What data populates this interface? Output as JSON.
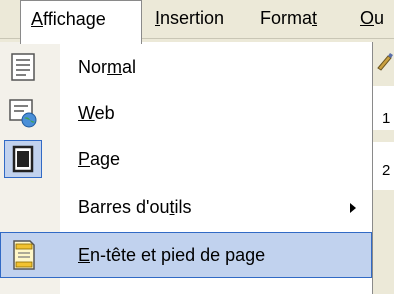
{
  "menubar": {
    "affichage": {
      "pre": "",
      "key": "A",
      "post": "ffichage"
    },
    "insertion": {
      "pre": "",
      "key": "I",
      "post": "nsertion"
    },
    "format": {
      "pre": "Forma",
      "key": "t",
      "post": ""
    },
    "outils": {
      "pre": "",
      "key": "O",
      "post": "u"
    }
  },
  "menu": {
    "normal": {
      "pre": "Nor",
      "key": "m",
      "post": "al",
      "icon": "normal-view-icon"
    },
    "web": {
      "pre": "",
      "key": "W",
      "post": "eb",
      "icon": "web-view-icon"
    },
    "page": {
      "pre": "",
      "key": "P",
      "post": "age",
      "icon": "page-view-icon"
    },
    "barres": {
      "pre": "Barres d'ou",
      "key": "t",
      "post": "ils"
    },
    "entete": {
      "pre": "",
      "key": "E",
      "post": "n-tête et pied de page",
      "icon": "header-footer-icon"
    }
  },
  "background": {
    "num1": "1",
    "num2": "2"
  },
  "colors": {
    "highlight_bg": "#c1d2ee",
    "highlight_border": "#316ac5",
    "menubar_bg": "#ece9d8"
  }
}
